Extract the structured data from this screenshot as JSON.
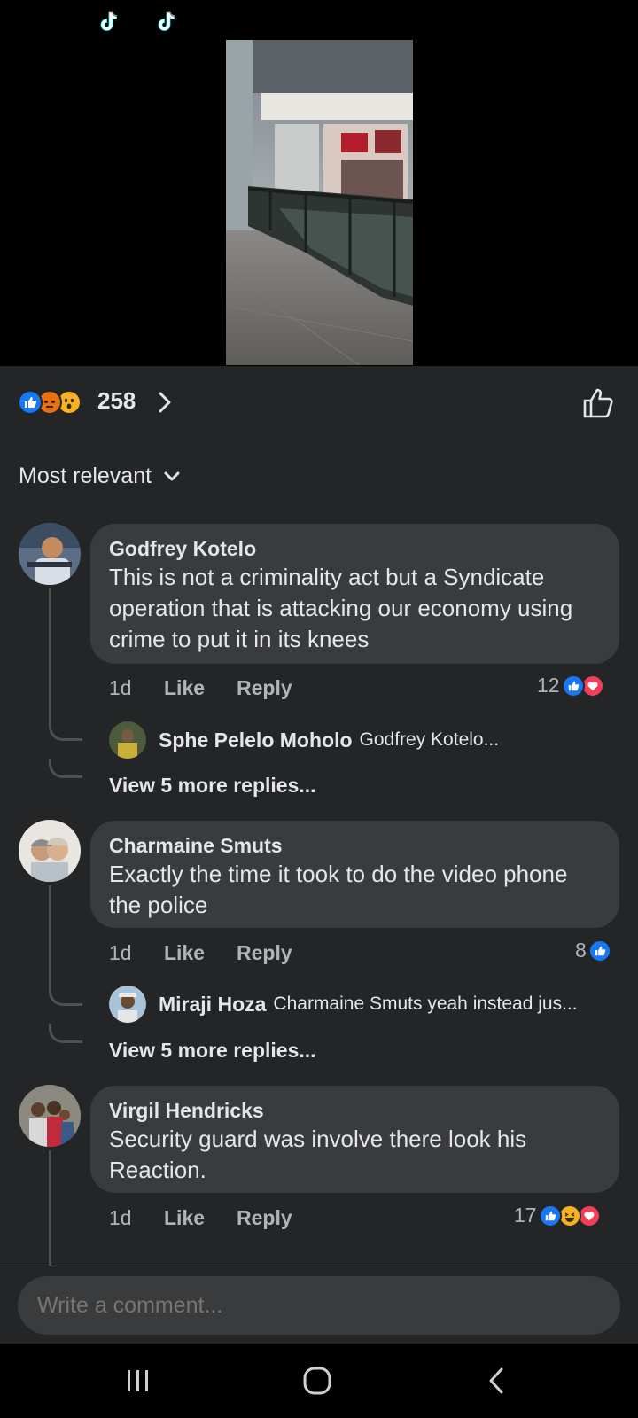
{
  "reactions": {
    "count": "258",
    "icons": [
      "like-icon",
      "angry-icon",
      "wow-icon"
    ]
  },
  "sort": {
    "label": "Most relevant"
  },
  "comments": [
    {
      "author": "Godfrey Kotelo",
      "text": "This is not a criminality act but a Syndicate operation that is attacking our economy using crime to put it in its knees",
      "time": "1d",
      "like_label": "Like",
      "reply_label": "Reply",
      "reaction_count": "12",
      "reaction_icons": [
        "like-icon",
        "love-icon"
      ],
      "reply_preview": {
        "author": "Sphe Pelelo Moholo",
        "snippet": "Godfrey Kotelo..."
      },
      "more_replies": "View 5 more replies..."
    },
    {
      "author": "Charmaine Smuts",
      "text": "Exactly the time it took to do the video phone the police",
      "time": "1d",
      "like_label": "Like",
      "reply_label": "Reply",
      "reaction_count": "8",
      "reaction_icons": [
        "like-icon"
      ],
      "reply_preview": {
        "author": "Miraji Hoza",
        "snippet": "Charmaine Smuts yeah instead jus..."
      },
      "more_replies": "View 5 more replies..."
    },
    {
      "author": "Virgil Hendricks",
      "text": "Security guard was involve there look his Reaction.",
      "time": "1d",
      "like_label": "Like",
      "reply_label": "Reply",
      "reaction_count": "17",
      "reaction_icons": [
        "like-icon",
        "haha-icon",
        "love-icon"
      ]
    }
  ],
  "composer": {
    "placeholder": "Write a comment..."
  },
  "navbar": {
    "icons": [
      "recents-icon",
      "home-icon",
      "back-icon"
    ]
  },
  "colors": {
    "like": "#1877f2",
    "love": "#f33e58",
    "angry": "#e9710f",
    "haha": "#f7b125",
    "background": "#242526",
    "bubble": "#3a3b3c"
  }
}
